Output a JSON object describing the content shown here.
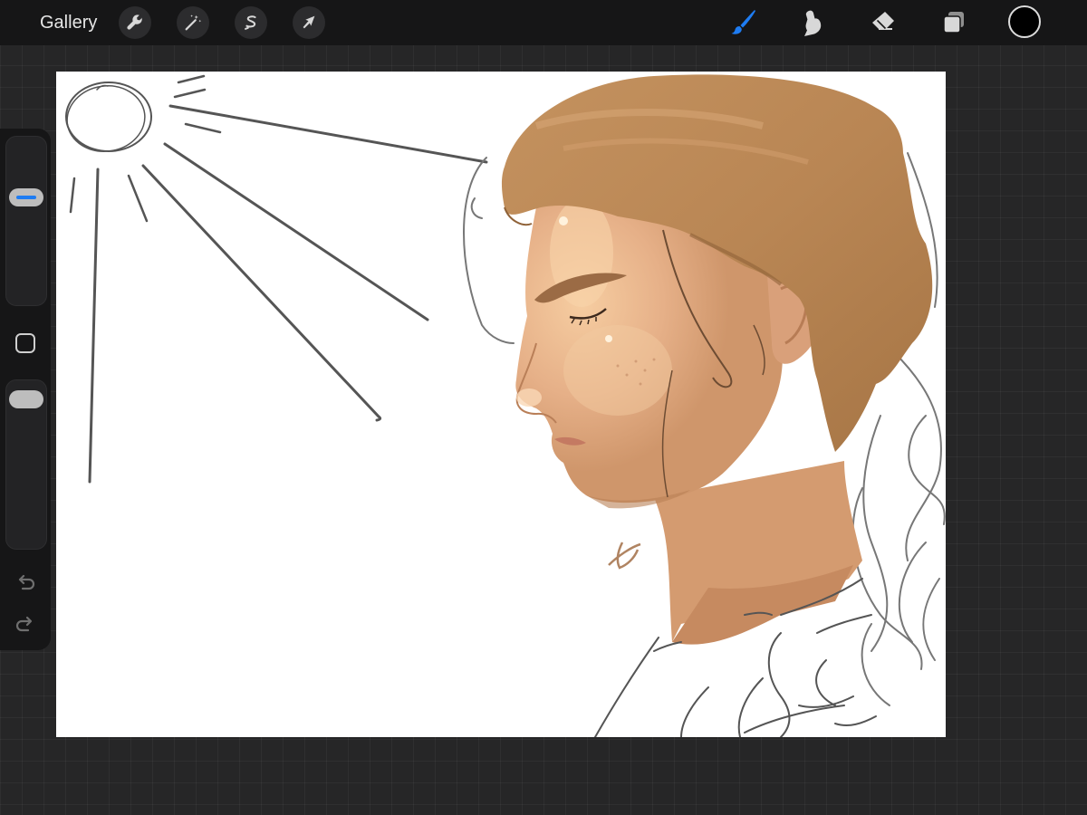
{
  "toolbar": {
    "gallery_label": "Gallery",
    "left_tools": [
      {
        "name": "actions",
        "icon": "wrench-icon"
      },
      {
        "name": "adjustments",
        "icon": "magic-wand-icon"
      },
      {
        "name": "selection",
        "icon": "selection-s-icon"
      },
      {
        "name": "transform",
        "icon": "arrow-cursor-icon"
      }
    ],
    "right_tools": [
      {
        "name": "brush",
        "icon": "brush-icon",
        "active": true
      },
      {
        "name": "smudge",
        "icon": "smudge-icon",
        "active": false
      },
      {
        "name": "eraser",
        "icon": "eraser-icon",
        "active": false
      },
      {
        "name": "layers",
        "icon": "layers-icon",
        "active": false
      }
    ],
    "current_color": "#000000",
    "accent_color": "#1e7cf2"
  },
  "sidebar": {
    "brush_size_level": 0.66,
    "brush_opacity_level": 0.95,
    "icons": [
      "modify-square-icon",
      "undo-icon",
      "redo-icon"
    ]
  }
}
